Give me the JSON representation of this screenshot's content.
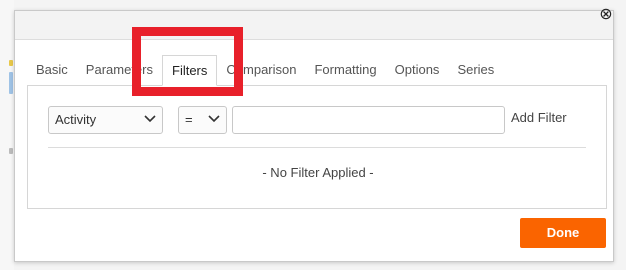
{
  "dialog": {
    "tabs": [
      {
        "label": "Basic"
      },
      {
        "label": "Parameters"
      },
      {
        "label": "Filters"
      },
      {
        "label": "Comparison"
      },
      {
        "label": "Formatting"
      },
      {
        "label": "Options"
      },
      {
        "label": "Series"
      }
    ],
    "active_tab": "Filters",
    "filters_panel": {
      "field_select": {
        "selected": "Activity"
      },
      "operator_select": {
        "selected": "="
      },
      "value_input": {
        "value": "",
        "placeholder": ""
      },
      "add_filter_label": "Add Filter",
      "empty_message": "- No Filter Applied -"
    },
    "done_label": "Done"
  },
  "icons": {
    "close": "close-icon",
    "chevron": "chevron-down-icon"
  },
  "colors": {
    "accent": "#fa6400",
    "highlight": "#e8202a",
    "border": "#d6d6d6"
  }
}
